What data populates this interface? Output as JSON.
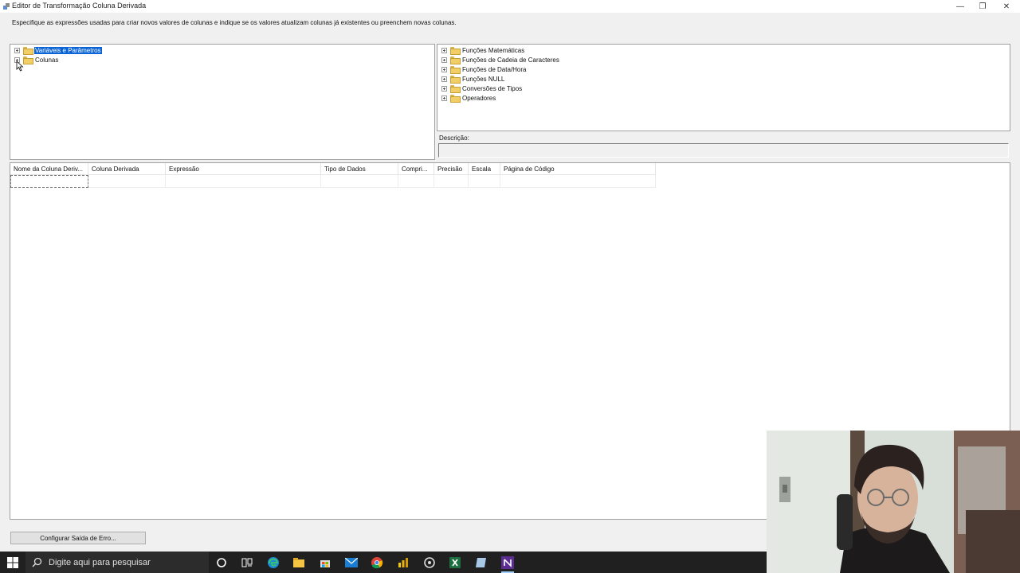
{
  "window": {
    "title": "Editor de Transformação Coluna Derivada",
    "minimize": "—",
    "restore": "❐",
    "close": "✕"
  },
  "instructions": "Especifique as expressões usadas para criar novos valores de colunas e indique se os valores atualizam colunas já existentes ou preenchem novas colunas.",
  "left_tree": {
    "items": [
      {
        "label": "Variáveis e Parâmetros",
        "selected": true
      },
      {
        "label": "Colunas",
        "selected": false
      }
    ]
  },
  "right_tree": {
    "items": [
      {
        "label": "Funções Matemáticas"
      },
      {
        "label": "Funções de Cadeia de Caracteres"
      },
      {
        "label": "Funções de Data/Hora"
      },
      {
        "label": "Funções NULL"
      },
      {
        "label": "Conversões de Tipos"
      },
      {
        "label": "Operadores"
      }
    ]
  },
  "description": {
    "label": "Descrição:",
    "value": ""
  },
  "grid": {
    "columns": [
      "Nome da Coluna Deriv...",
      "Coluna Derivada",
      "Expressão",
      "Tipo de Dados",
      "Compri...",
      "Precisão",
      "Escala",
      "Página de Código"
    ]
  },
  "buttons": {
    "configure_error_output": "Configurar Saída de Erro..."
  },
  "taskbar": {
    "search_placeholder": "Digite aqui para pesquisar",
    "icons": [
      "cortana-icon",
      "task-view-icon",
      "edge-icon",
      "file-explorer-icon",
      "store-icon",
      "mail-icon",
      "chrome-icon",
      "power-bi-icon",
      "settings-icon",
      "excel-icon",
      "sticky-notes-icon",
      "visual-studio-icon"
    ]
  },
  "colors": {
    "selection": "#0a64d8",
    "taskbar": "#202020",
    "dialog_bg": "#f0f0f0"
  }
}
